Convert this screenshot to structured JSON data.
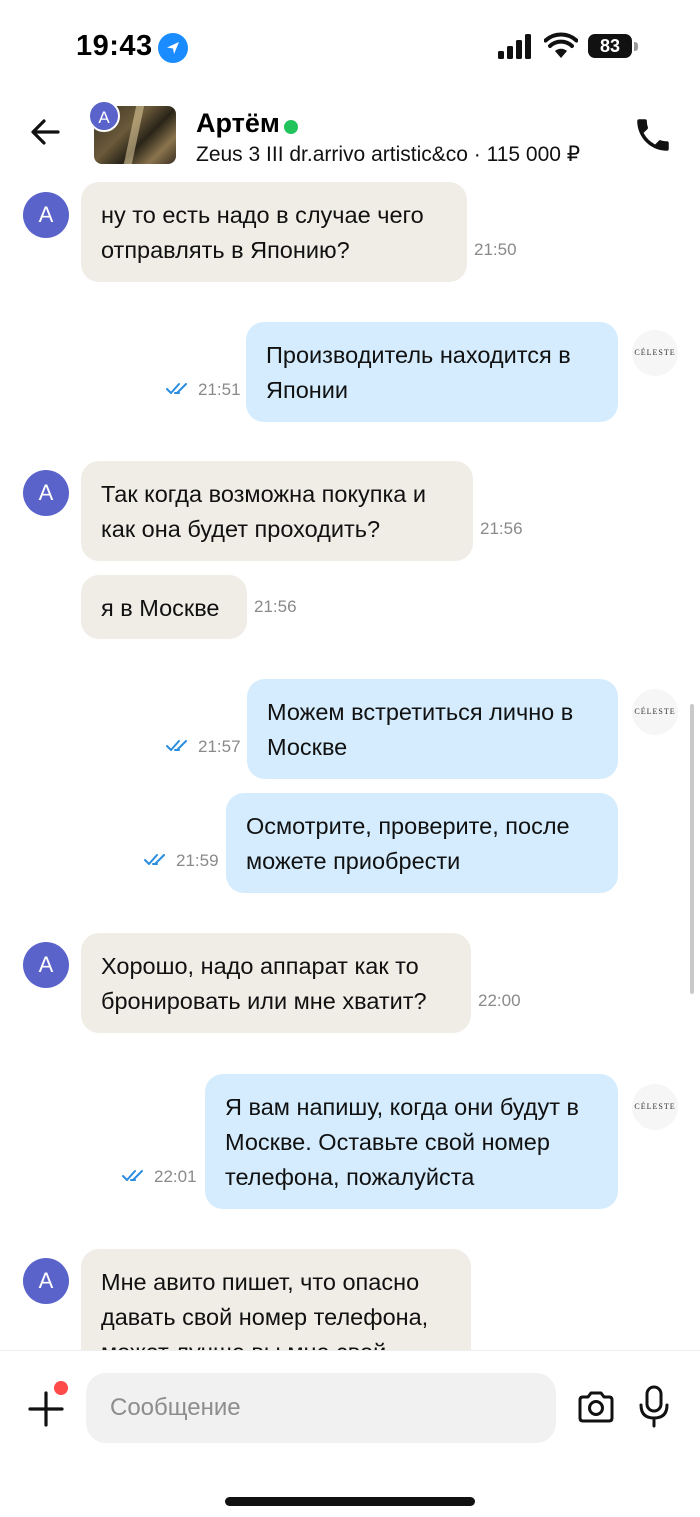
{
  "status_bar": {
    "time": "19:43",
    "battery": "83"
  },
  "header": {
    "contact_name": "Артём",
    "avatar_letter": "А",
    "listing": "Zeus 3 III dr.arrivo artistic&co · 115 000 ₽"
  },
  "shop_avatar_text": "CÉLESTE",
  "messages": [
    {
      "dir": "in",
      "avatar": "А",
      "text": "ну то есть надо в случае чего отправлять в Японию?",
      "time": "21:50"
    },
    {
      "dir": "out",
      "text": "Производитель находится в Японии",
      "time": "21:51"
    },
    {
      "dir": "in",
      "avatar": "А",
      "text": "Так когда возможна покупка и как она будет проходить?",
      "time": "21:56"
    },
    {
      "dir": "in",
      "text": "я в Москве",
      "time": "21:56"
    },
    {
      "dir": "out",
      "text": "Можем встретиться лично в Москве",
      "time": "21:57"
    },
    {
      "dir": "out",
      "text": "Осмотрите, проверите, после можете приобрести",
      "time": "21:59"
    },
    {
      "dir": "in",
      "avatar": "А",
      "text": "Хорошо, надо аппарат как то бронировать или мне хватит?",
      "time": "22:00"
    },
    {
      "dir": "out",
      "text": "Я вам напишу, когда они будут в Москве. Оставьте свой номер телефона, пожалуйста",
      "time": "22:01"
    },
    {
      "dir": "in",
      "avatar": "А",
      "text": "Мне авито пишет, что опасно давать свой номер телефона, может лучше вы мне свой"
    }
  ],
  "composer": {
    "placeholder": "Сообщение"
  },
  "colors": {
    "incoming": "#f0ede6",
    "outgoing": "#d4ecfd",
    "avatar": "#5a63c9",
    "online": "#21c35c",
    "read_ticks": "#2a8de0"
  }
}
